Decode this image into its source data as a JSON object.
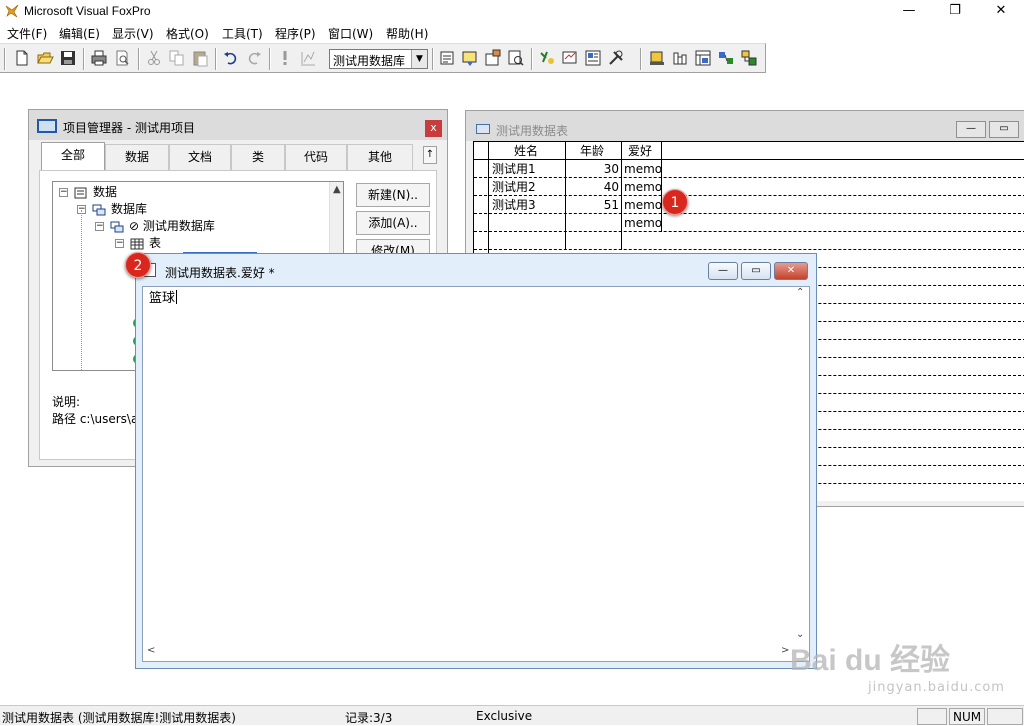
{
  "app": {
    "title": "Microsoft Visual FoxPro"
  },
  "window_controls": {
    "minimize": "—",
    "maximize": "❐",
    "close": "✕"
  },
  "menu": [
    {
      "label": "文件(F)"
    },
    {
      "label": "编辑(E)"
    },
    {
      "label": "显示(V)"
    },
    {
      "label": "格式(O)"
    },
    {
      "label": "工具(T)"
    },
    {
      "label": "程序(P)"
    },
    {
      "label": "窗口(W)"
    },
    {
      "label": "帮助(H)"
    }
  ],
  "toolbar": {
    "database_select": "测试用数据库",
    "icons": [
      "new-file-icon",
      "open-folder-icon",
      "save-icon",
      "print-icon",
      "print-preview-icon",
      "cut-icon",
      "copy-icon",
      "paste-icon",
      "undo-icon",
      "redo-icon",
      "run-icon",
      "modify-form-icon",
      "command-window-icon",
      "data-session-icon",
      "properties-icon",
      "code-window-icon",
      "form-builder-icon",
      "autoformat-icon",
      "report-designer-icon",
      "class-browser-icon",
      "tools-icon",
      "wizard-icon",
      "table-icon",
      "report-icon",
      "query-icon"
    ]
  },
  "project_manager": {
    "title": "项目管理器 - 测试用项目",
    "close_label": "x",
    "tabs": [
      "全部",
      "数据",
      "文档",
      "类",
      "代码",
      "其他"
    ],
    "tab_scroll_label": "↑",
    "tree": [
      {
        "label": "数据",
        "toggle": "−"
      },
      {
        "label": "数据库",
        "toggle": "−"
      },
      {
        "label": "⊘ 测试用数据库",
        "toggle": "−"
      },
      {
        "label": "表",
        "toggle": "−"
      }
    ],
    "buttons": [
      "新建(N)..",
      "添加(A)..",
      "修改(M)"
    ],
    "description_label": "说明:",
    "path_label": "路径 c:\\users\\a"
  },
  "table_window": {
    "title": "测试用数据表",
    "columns": [
      "姓名",
      "年龄",
      "爱好"
    ],
    "rows": [
      [
        "测试用1",
        "30",
        "memo"
      ],
      [
        "测试用2",
        "40",
        "memo"
      ],
      [
        "测试用3",
        "51",
        "memo"
      ],
      [
        "",
        "",
        "memo"
      ]
    ]
  },
  "memo_window": {
    "title": "测试用数据表.爱好 *",
    "content": "篮球"
  },
  "badges": {
    "one": "1",
    "two": "2"
  },
  "statusbar": {
    "table_info": "测试用数据表 (测试用数据库!测试用数据表)",
    "record": "记录:3/3",
    "mode": "Exclusive",
    "num": "NUM"
  },
  "watermark": {
    "logo": "Bai du 经验",
    "url": "jingyan.baidu.com"
  }
}
